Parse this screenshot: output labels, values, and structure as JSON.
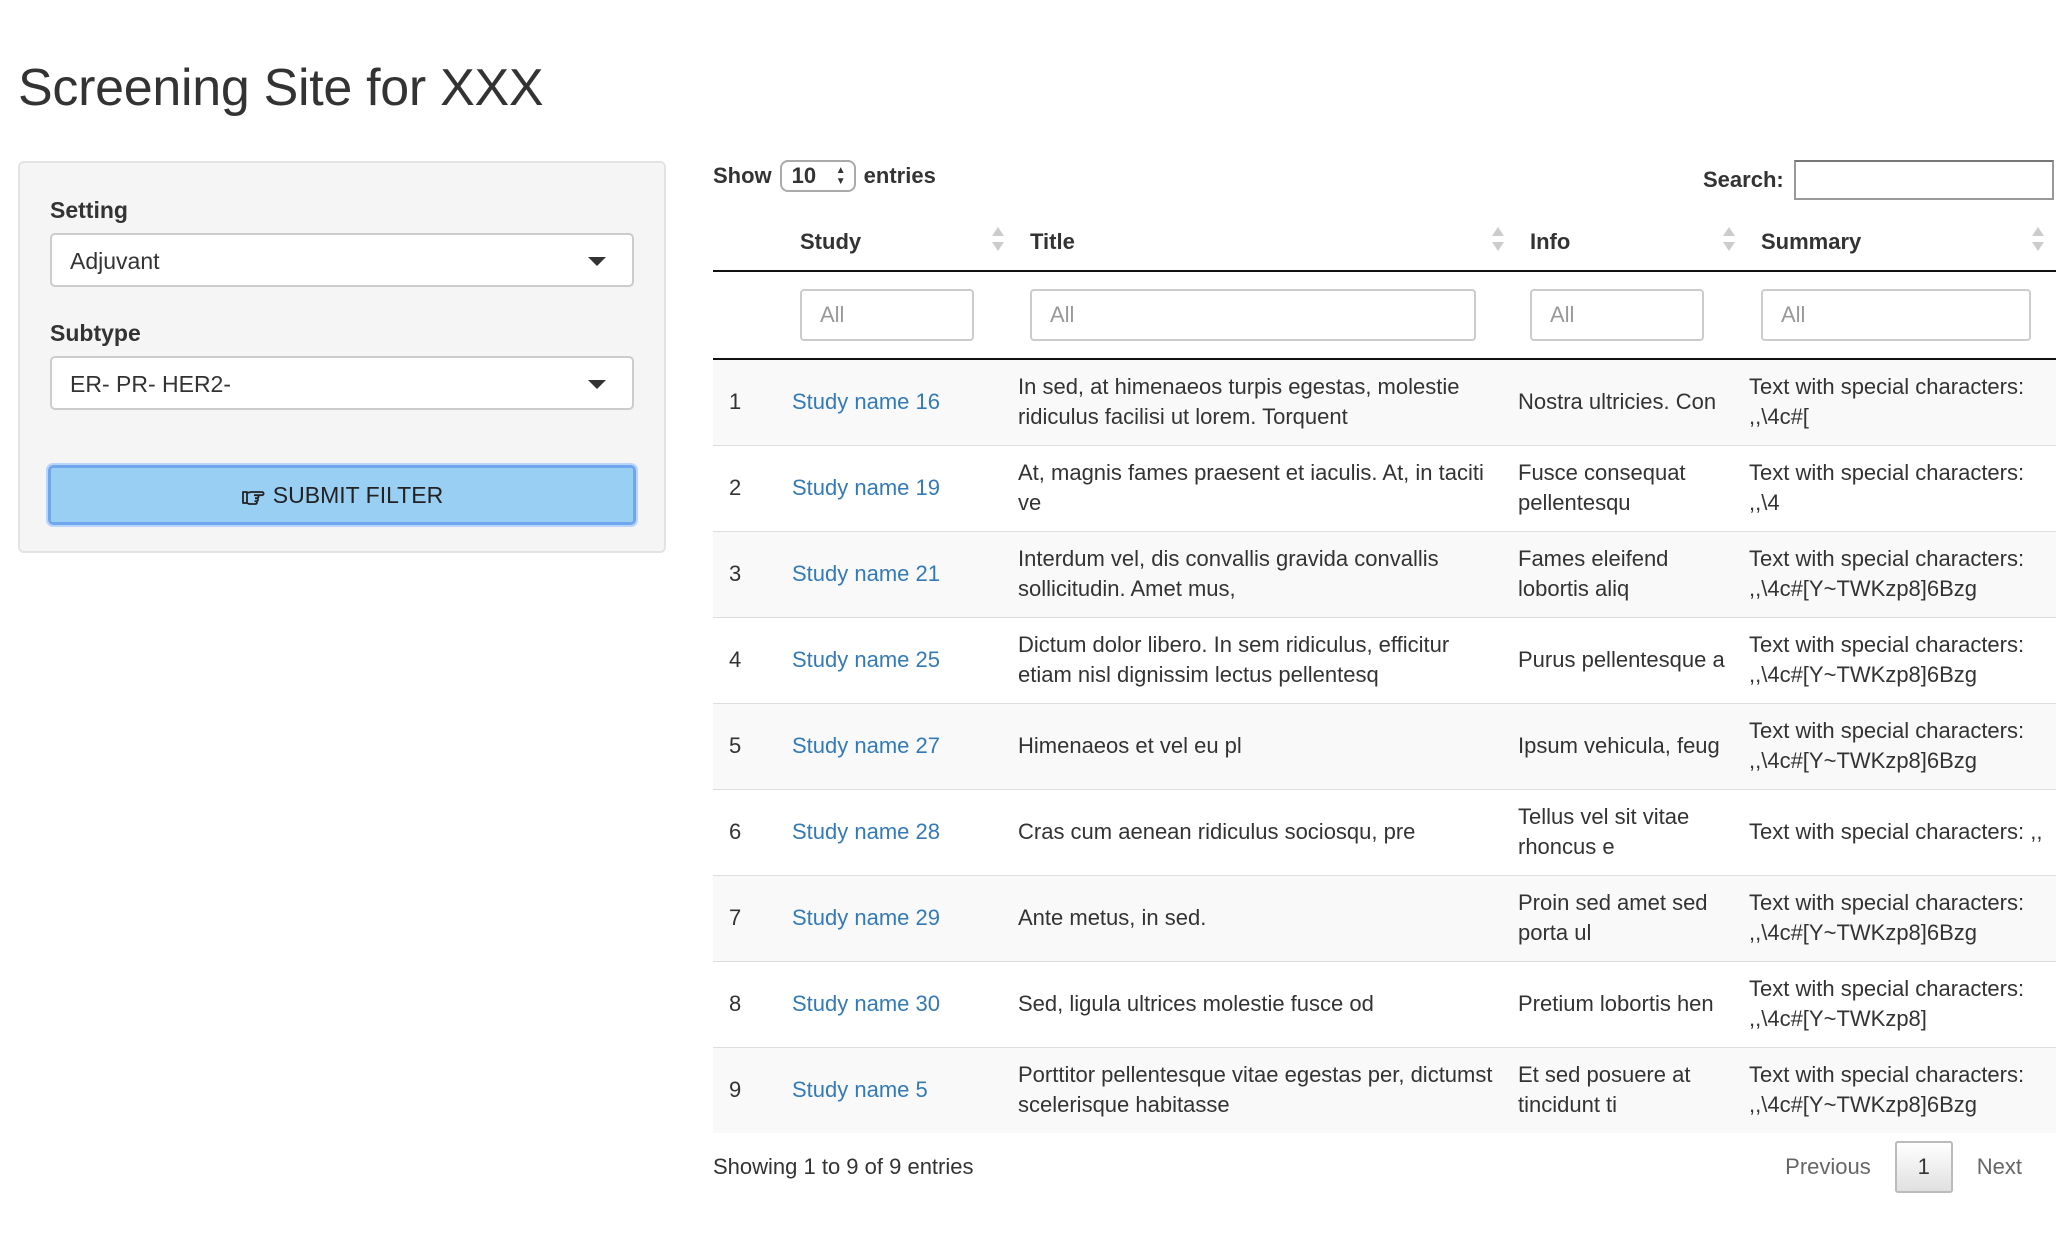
{
  "page_title": "Screening Site for XXX",
  "sidebar": {
    "setting_label": "Setting",
    "setting_value": "Adjuvant",
    "subtype_label": "Subtype",
    "subtype_value": "ER- PR- HER2-",
    "submit_label": "SUBMIT FILTER",
    "submit_icon": "hand-pointing-icon",
    "submit_color": "#9acff4"
  },
  "table_controls": {
    "show_label": "Show",
    "page_length": "10",
    "entries_label": "entries",
    "search_label": "Search:",
    "search_value": ""
  },
  "columns": [
    "Study",
    "Title",
    "Info",
    "Summary"
  ],
  "filters": {
    "study": "All",
    "title": "All",
    "info": "All",
    "summary": "All"
  },
  "rows": [
    {
      "n": "1",
      "study": "Study name 16",
      "title": "In sed, at himenaeos turpis egestas, molestie ridiculus facilisi ut lorem. Torquent",
      "info": "Nostra ultricies. Con",
      "summary": "Text with special characters: ,,\\4c#["
    },
    {
      "n": "2",
      "study": "Study name 19",
      "title": "At, magnis fames praesent et iaculis. At, in taciti ve",
      "info": "Fusce consequat pellentesqu",
      "summary": "Text with special characters: ,,\\4"
    },
    {
      "n": "3",
      "study": "Study name 21",
      "title": "Interdum vel, dis convallis gravida convallis sollicitudin. Amet mus,",
      "info": "Fames eleifend lobortis aliq",
      "summary": "Text with special characters: ,,\\4c#[Y~TWKzp8]6Bzg"
    },
    {
      "n": "4",
      "study": "Study name 25",
      "title": "Dictum dolor libero. In sem ridiculus, efficitur etiam nisl dignissim lectus pellentesq",
      "info": "Purus pellentesque a",
      "summary": "Text with special characters: ,,\\4c#[Y~TWKzp8]6Bzg"
    },
    {
      "n": "5",
      "study": "Study name 27",
      "title": "Himenaeos et vel eu pl",
      "info": "Ipsum vehicula, feug",
      "summary": "Text with special characters: ,,\\4c#[Y~TWKzp8]6Bzg"
    },
    {
      "n": "6",
      "study": "Study name 28",
      "title": "Cras cum aenean ridiculus sociosqu, pre",
      "info": "Tellus vel sit vitae rhoncus e",
      "summary": "Text with special characters: ,,"
    },
    {
      "n": "7",
      "study": "Study name 29",
      "title": "Ante metus, in sed.",
      "info": "Proin sed amet sed porta ul",
      "summary": "Text with special characters: ,,\\4c#[Y~TWKzp8]6Bzg"
    },
    {
      "n": "8",
      "study": "Study name 30",
      "title": "Sed, ligula ultrices molestie fusce od",
      "info": "Pretium lobortis hen",
      "summary": "Text with special characters: ,,\\4c#[Y~TWKzp8]"
    },
    {
      "n": "9",
      "study": "Study name 5",
      "title": "Porttitor pellentesque vitae egestas per, dictumst scelerisque habitasse",
      "info": "Et sed posuere at tincidunt ti",
      "summary": "Text with special characters: ,,\\4c#[Y~TWKzp8]6Bzg"
    }
  ],
  "footer": {
    "info": "Showing 1 to 9 of 9 entries",
    "previous": "Previous",
    "current_page": "1",
    "next": "Next"
  },
  "colors": {
    "link": "#337ab7",
    "button": "#9acff4",
    "button_border": "#6fa6ee"
  }
}
